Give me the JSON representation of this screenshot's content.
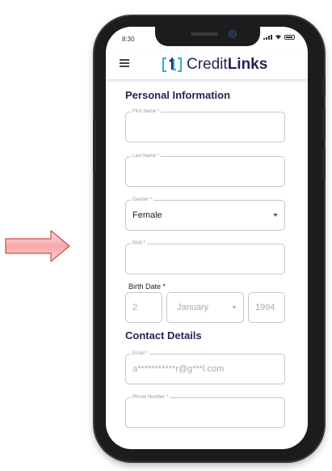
{
  "status_bar": {
    "time": "8:30"
  },
  "header": {
    "brand_prefix": "Credit",
    "brand_suffix": "Links"
  },
  "personal_section": {
    "title": "Personal Information",
    "first_name": {
      "label": "First Name *",
      "value": ""
    },
    "last_name": {
      "label": "Last Name *",
      "value": ""
    },
    "gender": {
      "label": "Gender *",
      "value": "Female"
    },
    "pan": {
      "label": "PAN *",
      "value": ""
    },
    "birth_date": {
      "label": "Birth Date *",
      "day": "2",
      "month": "January",
      "year": "1994"
    }
  },
  "contact_section": {
    "title": "Contact Details",
    "email": {
      "label": "Email *",
      "value": "a***********r@g***l.com"
    },
    "phone": {
      "label": "Phone Number *",
      "value": ""
    }
  },
  "colors": {
    "brand_navy": "#1f2459",
    "logo_teal": "#2fb2c8",
    "arrow_fill": "#f7b3b3",
    "arrow_stroke": "#c94a4a"
  }
}
